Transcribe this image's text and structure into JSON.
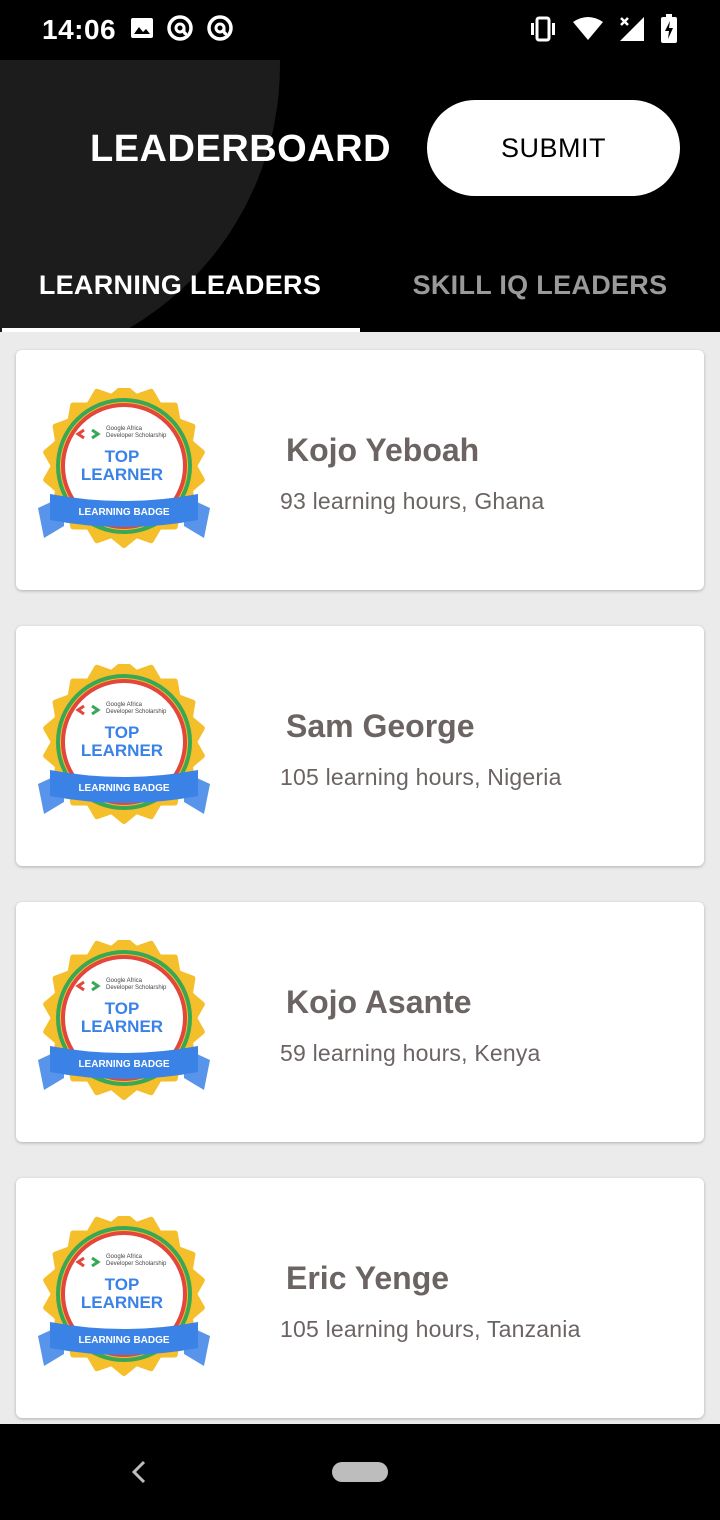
{
  "status_bar": {
    "time": "14:06",
    "left_icons": [
      "image-icon",
      "at-sign-icon",
      "at-sign-icon"
    ],
    "right_icons": [
      "vibrate-icon",
      "wifi-icon",
      "signal-icon",
      "battery-charging-icon"
    ]
  },
  "header": {
    "title": "LEADERBOARD",
    "submit_label": "SUBMIT"
  },
  "tabs": [
    {
      "label": "LEARNING LEADERS",
      "active": true
    },
    {
      "label": "SKILL IQ LEADERS",
      "active": false
    }
  ],
  "badge": {
    "org_line1": "Google Africa",
    "org_line2": "Developer Scholarship",
    "top": "TOP",
    "learner": "LEARNER",
    "ribbon": "LEARNING BADGE"
  },
  "leaders": [
    {
      "name": "Kojo Yeboah",
      "detail": "93 learning hours, Ghana"
    },
    {
      "name": "Sam George",
      "detail": "105 learning hours, Nigeria"
    },
    {
      "name": "Kojo Asante",
      "detail": "59 learning hours, Kenya"
    },
    {
      "name": "Eric Yenge",
      "detail": "105 learning hours, Tanzania"
    }
  ],
  "colors": {
    "badge_gold": "#f4bf2a",
    "badge_blue": "#3b82e6",
    "badge_red": "#e2463c",
    "badge_green": "#3aa757",
    "text_gray": "#6b6462"
  }
}
